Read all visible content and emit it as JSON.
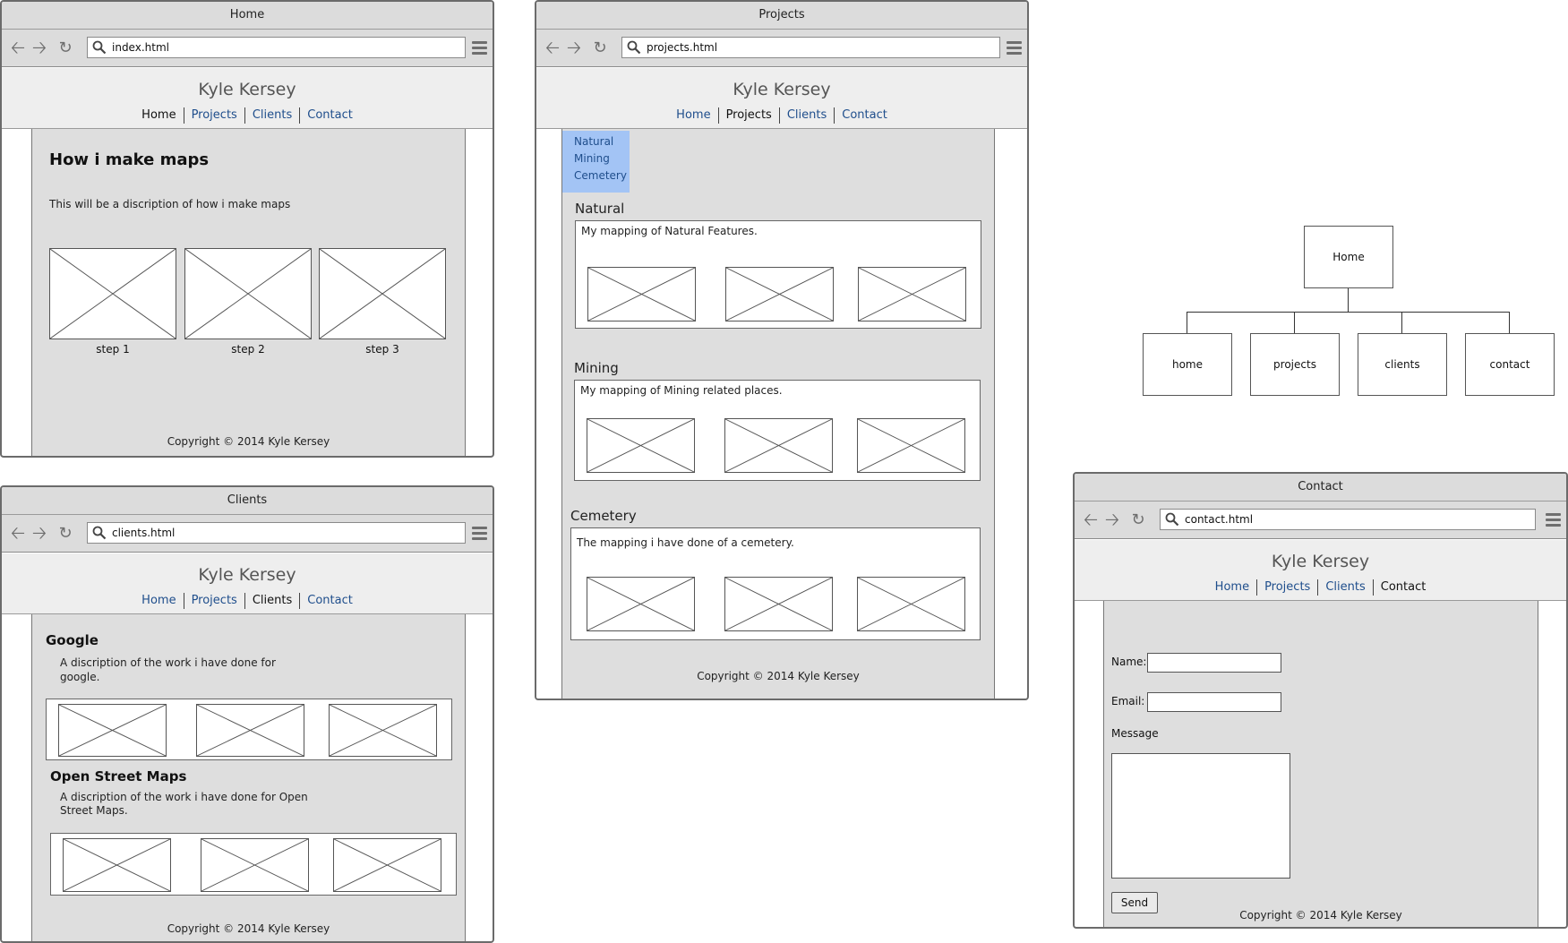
{
  "sitemap": {
    "root": "Home",
    "children": [
      "home",
      "projects",
      "clients",
      "contact"
    ]
  },
  "site": {
    "title": "Kyle Kersey",
    "nav": [
      "Home",
      "Projects",
      "Clients",
      "Contact"
    ],
    "copyright": "Copyright © 2014 Kyle Kersey"
  },
  "home_page": {
    "window_title": "Home",
    "url": "index.html",
    "heading": "How i make maps",
    "description": "This will be a discription of how i make maps",
    "steps": [
      "step 1",
      "step 2",
      "step 3"
    ]
  },
  "clients_page": {
    "window_title": "Clients",
    "url": "clients.html",
    "clients": [
      {
        "name": "Google",
        "description_line1": "A discription of the work i have done for",
        "description_line2": "google."
      },
      {
        "name": "Open Street Maps",
        "description_line1": "A discription of the work i have done for Open",
        "description_line2": "Street Maps."
      }
    ]
  },
  "projects_page": {
    "window_title": "Projects",
    "url": "projects.html",
    "submenu": [
      "Natural",
      "Mining",
      "Cemetery"
    ],
    "sections": [
      {
        "name": "Natural",
        "description": "My mapping of Natural Features."
      },
      {
        "name": "Mining",
        "description": "My mapping of Mining related places."
      },
      {
        "name": "Cemetery",
        "description": "The mapping i have done of a cemetery."
      }
    ]
  },
  "contact_page": {
    "window_title": "Contact",
    "url": "contact.html",
    "name_label": "Name:",
    "email_label": "Email:",
    "message_label": "Message",
    "send_label": "Send"
  }
}
